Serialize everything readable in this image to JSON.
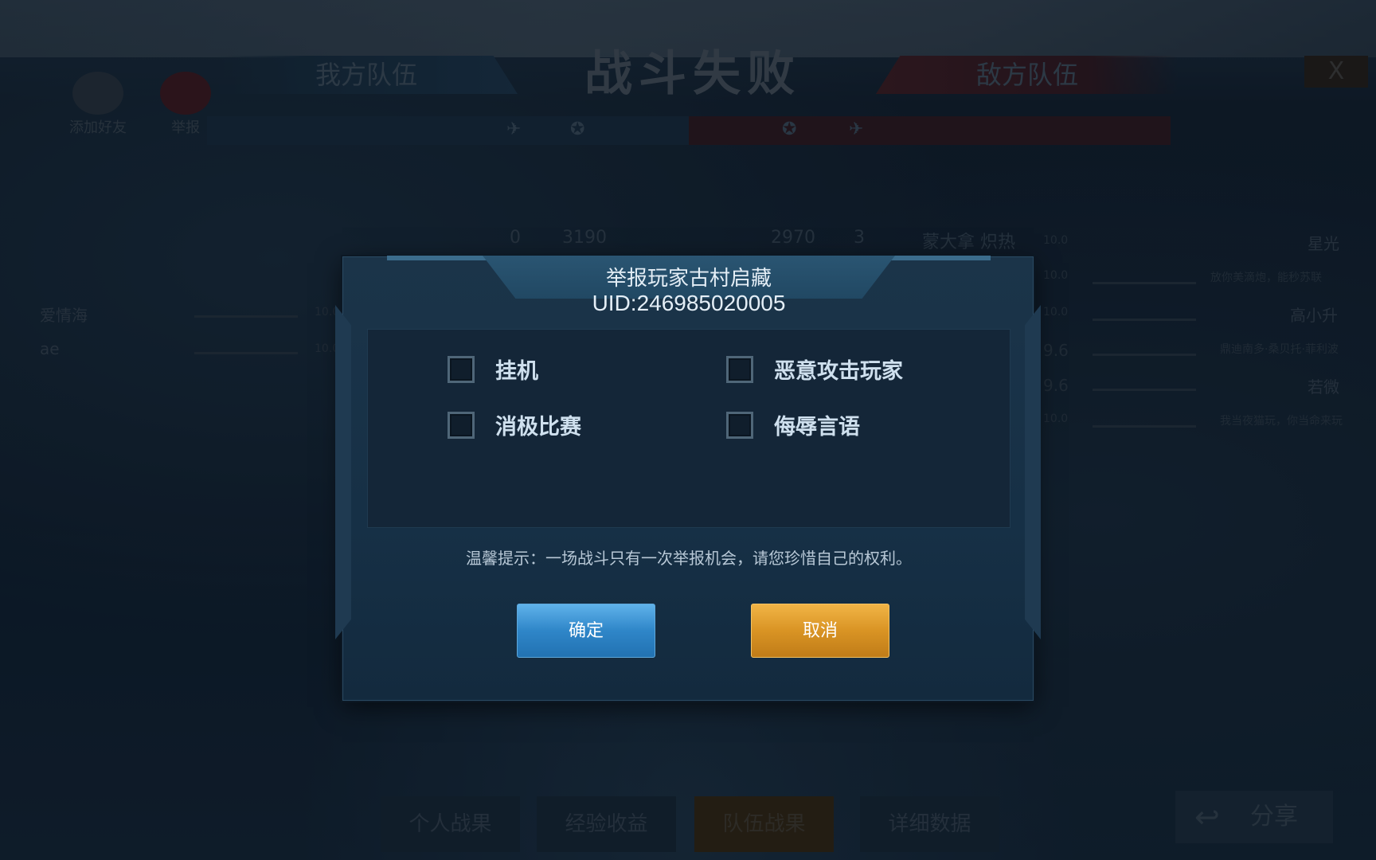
{
  "background": {
    "result_title": "战斗失败",
    "ally_team_label": "我方队伍",
    "enemy_team_label": "敌方队伍",
    "close_glyph": "X",
    "side_buttons": {
      "add_friend": "添加好友",
      "report": "举报"
    },
    "stat_row": {
      "ally_kills": "0",
      "ally_score": "3190",
      "enemy_score": "2970",
      "enemy_kills": "3",
      "enemy_name": "蒙大拿 炽热"
    },
    "ally_rows": [
      {
        "name": "爱情海",
        "score": "10.0"
      },
      {
        "name": "ae",
        "score": "10.0"
      }
    ],
    "enemy_rows": [
      {
        "name": "星光",
        "score": "10.0",
        "motto": ""
      },
      {
        "name": "",
        "score": "10.0",
        "motto": "放你美滴炮，能秒苏联"
      },
      {
        "name": "高小升",
        "score": "10.0",
        "motto": ""
      },
      {
        "name": "",
        "score": "9.6",
        "motto": "鼎迪南多·桑贝托·菲利波"
      },
      {
        "name": "若微",
        "score": "9.6",
        "motto": ""
      },
      {
        "name": "",
        "score": "10.0",
        "motto": "我当夜猫玩，你当命来玩"
      }
    ],
    "bottom_tabs": [
      "个人战果",
      "经验收益",
      "队伍战果",
      "详细数据"
    ],
    "share_label": "分享"
  },
  "dialog": {
    "title": "举报玩家古村启藏",
    "uid": "UID:246985020005",
    "options": [
      {
        "label": "挂机",
        "checked": false
      },
      {
        "label": "恶意攻击玩家",
        "checked": false
      },
      {
        "label": "消极比赛",
        "checked": false
      },
      {
        "label": "侮辱言语",
        "checked": false
      }
    ],
    "tip": "温馨提示：一场战斗只有一次举报机会，请您珍惜自己的权利。",
    "confirm_label": "确定",
    "cancel_label": "取消"
  },
  "colors": {
    "confirm_blue": "#2f86c8",
    "cancel_orange": "#d99424",
    "dialog_bg": "#163046"
  }
}
